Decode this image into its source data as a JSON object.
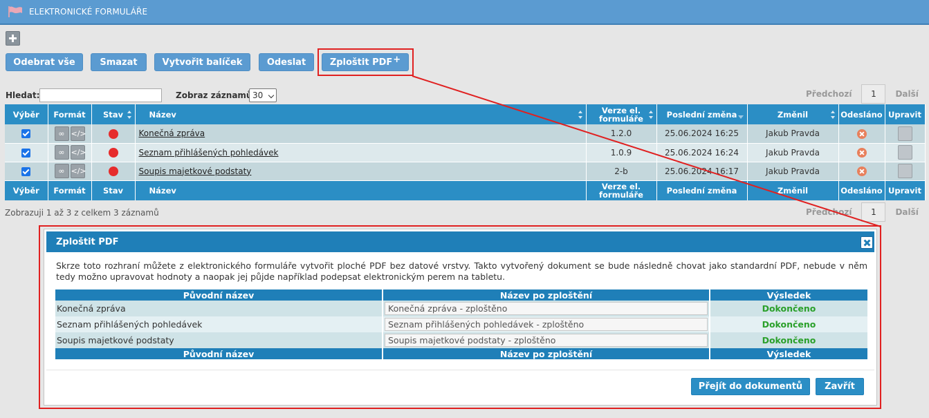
{
  "header": {
    "title": "ELEKTRONICKÉ FORMULÁŘE",
    "icon": "flag-icon"
  },
  "toolbar": {
    "add_icon": "plus-icon",
    "buttons": [
      "Odebrat vše",
      "Smazat",
      "Vytvořit balíček",
      "Odeslat",
      "Zploštit PDF"
    ],
    "flatten_suffix": "+"
  },
  "search": {
    "label": "Hledat:",
    "value": ""
  },
  "show": {
    "label": "Zobraz záznamů:",
    "value": "30"
  },
  "pager": {
    "prev": "Předchozí",
    "page": "1",
    "next": "Další"
  },
  "grid": {
    "columns": [
      "Výběr",
      "Formát",
      "Stav",
      "Název",
      "Verze el. formuláře",
      "Poslední změna",
      "Změnil",
      "Odesláno",
      "Upravit"
    ],
    "rows": [
      {
        "name": "Konečná zpráva",
        "version": "1.2.0",
        "changed": "25.06.2024 16:25",
        "user": "Jakub Pravda"
      },
      {
        "name": "Seznam přihlášených pohledávek",
        "version": "1.0.9",
        "changed": "25.06.2024 16:24",
        "user": "Jakub Pravda"
      },
      {
        "name": "Soupis majetkové podstaty",
        "version": "2-b",
        "changed": "25.06.2024 16:17",
        "user": "Jakub Pravda"
      }
    ],
    "footer_info": "Zobrazuji 1 až 3 z celkem 3 záznamů"
  },
  "colors": {
    "accent": "#2b8ec5",
    "titlebar": "#5b9bd1",
    "highlight": "#e02020",
    "done": "#2aa02a"
  },
  "modal": {
    "title": "Zploštit PDF",
    "text": "Skrze toto rozhraní můžete z elektronického formuláře vytvořit ploché PDF bez datové vrstvy. Takto vytvořený dokument se bude následně chovat jako standardní PDF, nebude v něm tedy možno upravovat hodnoty a naopak jej půjde například podepsat elektronickým perem na tabletu.",
    "columns": [
      "Původní název",
      "Název po zploštění",
      "Výsledek"
    ],
    "rows": [
      {
        "original": "Konečná zpráva",
        "flattened": "Konečná zpráva - zploštěno",
        "result": "Dokončeno"
      },
      {
        "original": "Seznam přihlášených pohledávek",
        "flattened": "Seznam přihlášených pohledávek - zploštěno",
        "result": "Dokončeno"
      },
      {
        "original": "Soupis majetkové podstaty",
        "flattened": "Soupis majetkové podstaty - zploštěno",
        "result": "Dokončeno"
      }
    ],
    "buttons": {
      "documents": "Přejít do dokumentů",
      "close": "Zavřít"
    }
  }
}
